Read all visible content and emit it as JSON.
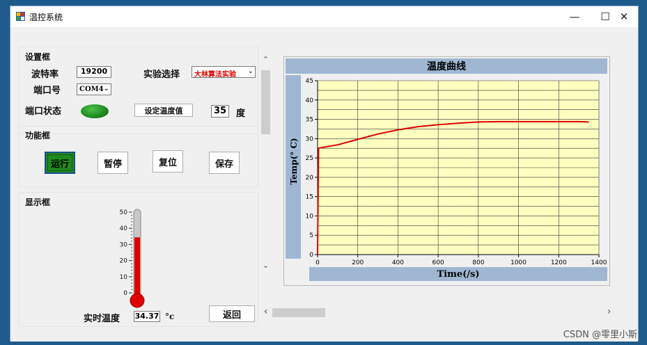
{
  "window": {
    "title": "温控系统",
    "minimize": "—",
    "maximize": "☐",
    "close": "✕"
  },
  "settings": {
    "group_label": "设置框",
    "baud_label": "波特率",
    "baud_value": "19200",
    "experiment_label": "实验选择",
    "experiment_value": "大林算法实验",
    "port_label": "端口号",
    "port_value": "COM4",
    "port_status_label": "端口状态",
    "port_status_color": "#1e8a1e",
    "set_temp_button": "设定温度值",
    "set_temp_value": "35",
    "degree_unit": "度"
  },
  "functions": {
    "group_label": "功能框",
    "run": "运行",
    "pause": "暂停",
    "reset": "复位",
    "save": "保存",
    "run_color": "#1e8a1e"
  },
  "display": {
    "group_label": "显示框",
    "thermometer_ticks": [
      "50",
      "40",
      "30",
      "20",
      "10",
      "0"
    ],
    "thermometer_level": 34.37,
    "thermometer_max": 50,
    "realtime_label": "实时温度",
    "realtime_value": "34.37",
    "unit": "°c",
    "back_button": "返回"
  },
  "scroll": {
    "up": "⌃",
    "down": "⌄",
    "left": "‹",
    "right": "›"
  },
  "watermark": "CSDN @零里小斯",
  "chart_data": {
    "type": "line",
    "title": "温度曲线",
    "xlabel": "Time(/s)",
    "ylabel": "Temp(° C)",
    "xlim": [
      0,
      1400
    ],
    "ylim": [
      0,
      45
    ],
    "x_ticks": [
      "0",
      "200",
      "400",
      "600",
      "800",
      "1000",
      "1200",
      "1400"
    ],
    "y_ticks": [
      "0",
      "5",
      "10",
      "15",
      "20",
      "25",
      "30",
      "35",
      "40",
      "45"
    ],
    "grid": true,
    "line_color": "#e00000",
    "plot_bg": "#ffffc0",
    "header_bg": "#9fb7d3",
    "series": [
      {
        "x": [
          0,
          5,
          10,
          100,
          200,
          300,
          400,
          500,
          600,
          700,
          800,
          900,
          1000,
          1100,
          1200,
          1300,
          1350
        ],
        "y": [
          0,
          27.5,
          27.6,
          28.4,
          29.8,
          31.2,
          32.3,
          33.1,
          33.6,
          34.0,
          34.3,
          34.4,
          34.4,
          34.4,
          34.4,
          34.4,
          34.3
        ]
      }
    ]
  }
}
